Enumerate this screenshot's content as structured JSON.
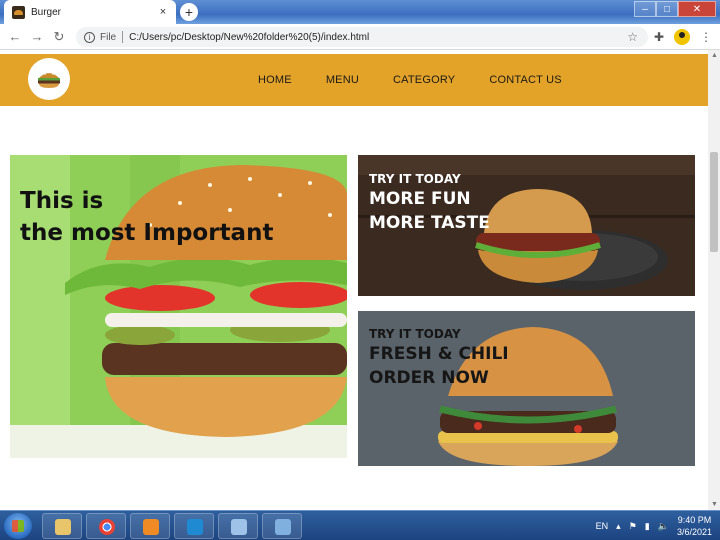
{
  "browser": {
    "tab_title": "Burger",
    "tab_close": "×",
    "new_tab": "+",
    "scheme_label": "File",
    "url": "C:/Users/pc/Desktop/New%20folder%20(5)/index.html",
    "window_controls": {
      "minimize": "–",
      "maximize": "□",
      "close": "✕"
    },
    "icons": [
      "back-arrow-icon",
      "forward-arrow-icon",
      "reload-icon",
      "info-icon",
      "star-icon",
      "extensions-puzzle-icon",
      "profile-avatar-icon",
      "menu-dots-icon"
    ]
  },
  "site": {
    "nav": [
      "HOME",
      "MENU",
      "CATEGORY",
      "CONTACT US"
    ],
    "header_color": "#e3a328",
    "hero_big": {
      "line1": "This is",
      "line2": "the most Important"
    },
    "hero_top": {
      "eyebrow": "TRY IT TODAY",
      "line1": "MORE FUN",
      "line2": "MORE TASTE"
    },
    "hero_bottom": {
      "eyebrow": "TRY IT TODAY",
      "line1": "FRESH & CHILI",
      "line2": "ORDER NOW"
    }
  },
  "taskbar": {
    "apps": [
      "file-explorer-icon",
      "chrome-icon",
      "xampp-icon",
      "vscode-icon",
      "window-switcher-icon",
      "paint-icon"
    ],
    "language": "EN",
    "time": "9:40 PM",
    "date": "3/6/2021"
  }
}
